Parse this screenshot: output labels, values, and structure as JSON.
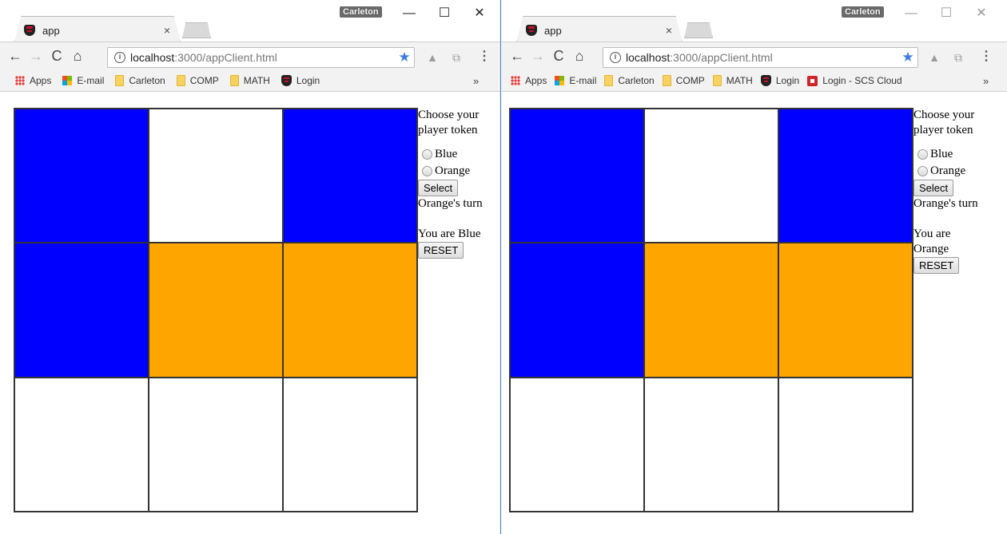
{
  "colors": {
    "blue": "#0000ff",
    "orange": "#ffa500",
    "empty": "#ffffff"
  },
  "windows": [
    {
      "profile": "Carleton",
      "controls": {
        "minimize": "—",
        "maximize": "☐",
        "close": "✕"
      },
      "tab": {
        "title": "app",
        "close": "×"
      },
      "nav": {
        "back": "←",
        "forward": "→",
        "reload": "C",
        "home": "⌂"
      },
      "url": {
        "host": "localhost",
        "rest": ":3000/appClient.html"
      },
      "bookmarks": [
        "Apps",
        "E-mail",
        "Carleton",
        "COMP",
        "MATH",
        "Login"
      ],
      "more": "»",
      "board": [
        "blue",
        "empty",
        "blue",
        "blue",
        "orange",
        "orange",
        "empty",
        "empty",
        "empty"
      ],
      "panel": {
        "prompt": "Choose your player token",
        "option_blue": "Blue",
        "option_orange": "Orange",
        "select_label": "Select",
        "turn": "Orange's turn",
        "you_are": "You are Blue",
        "reset_label": "RESET"
      }
    },
    {
      "profile": "Carleton",
      "controls": {
        "minimize": "—",
        "maximize": "☐",
        "close": "✕"
      },
      "tab": {
        "title": "app",
        "close": "×"
      },
      "nav": {
        "back": "←",
        "forward": "→",
        "reload": "C",
        "home": "⌂"
      },
      "url": {
        "host": "localhost",
        "rest": ":3000/appClient.html"
      },
      "bookmarks": [
        "Apps",
        "E-mail",
        "Carleton",
        "COMP",
        "MATH",
        "Login",
        "Login - SCS Cloud"
      ],
      "more": "»",
      "board": [
        "blue",
        "empty",
        "blue",
        "blue",
        "orange",
        "orange",
        "empty",
        "empty",
        "empty"
      ],
      "panel": {
        "prompt": "Choose your player token",
        "option_blue": "Blue",
        "option_orange": "Orange",
        "select_label": "Select",
        "turn": "Orange's turn",
        "you_are": "You are Orange",
        "reset_label": "RESET"
      }
    }
  ]
}
